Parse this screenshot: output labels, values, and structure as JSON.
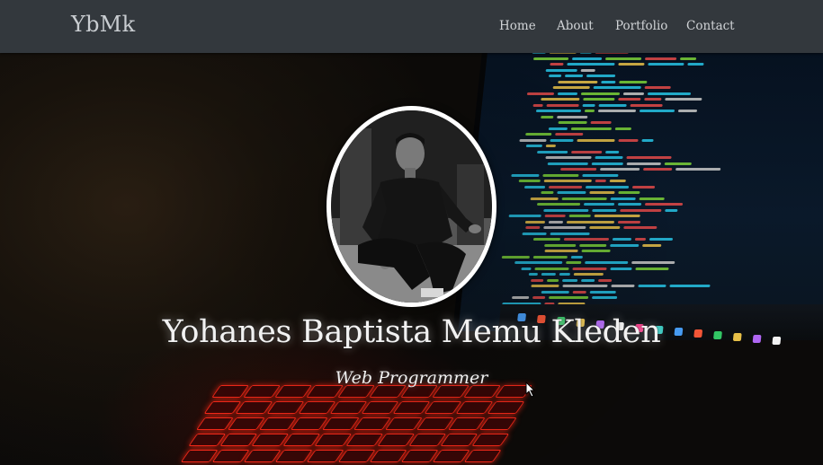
{
  "navbar": {
    "brand": "YbMk",
    "links": [
      {
        "label": "Home"
      },
      {
        "label": "About"
      },
      {
        "label": "Portfolio"
      },
      {
        "label": "Contact"
      }
    ]
  },
  "hero": {
    "name": "Yohanes Baptista Memu Kleden",
    "role": "Web Programmer"
  },
  "colors": {
    "navbar_bg": "#33383d",
    "nav_text": "#d0d3d6",
    "hero_text": "#f2f2f2",
    "code_green": "#7bd13a",
    "code_cyan": "#27c3e6",
    "key_red": "#ff2a1a"
  }
}
